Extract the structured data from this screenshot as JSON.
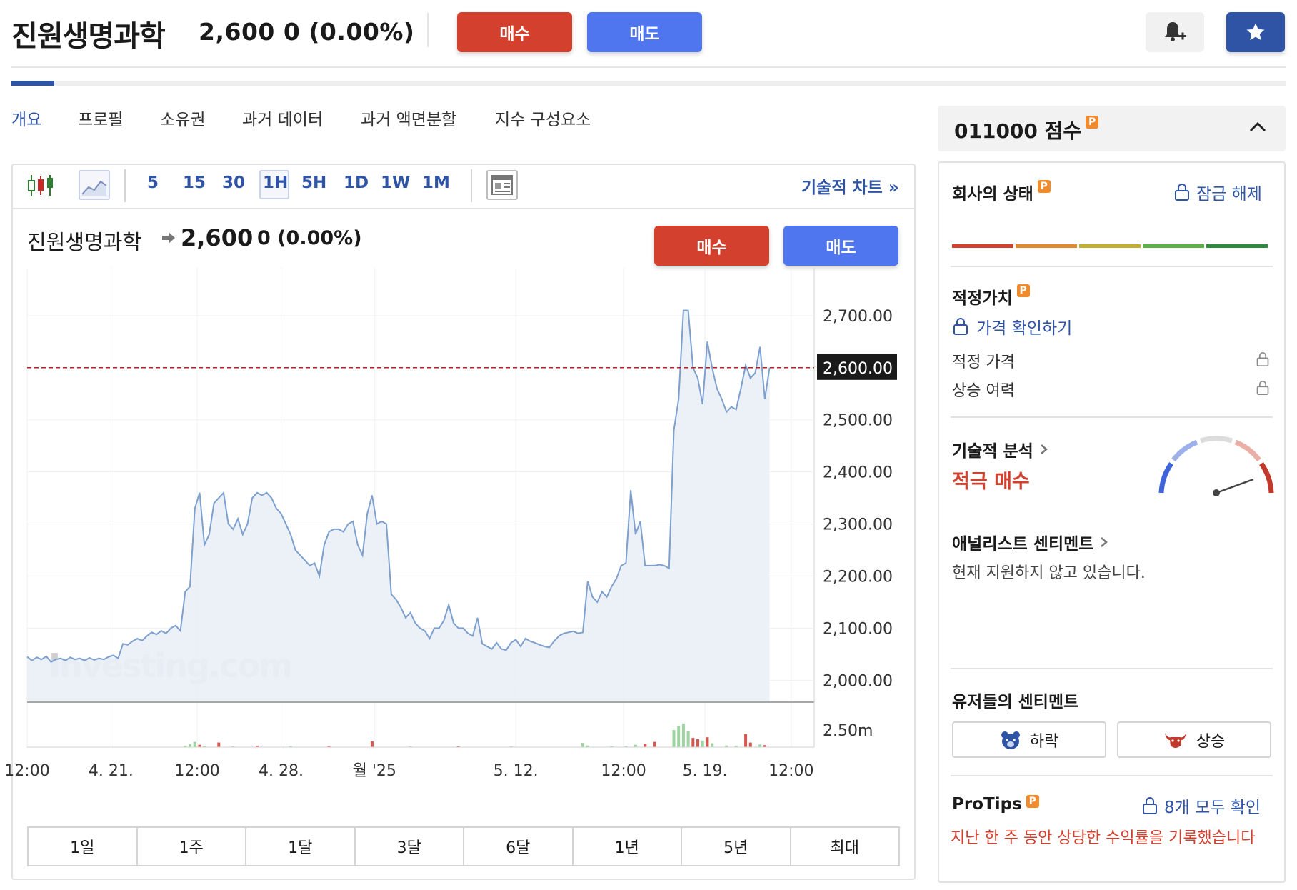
{
  "header": {
    "title": "진원생명과학",
    "price_line": "2,600  0  (0.00%)",
    "buy_label": "매수",
    "sell_label": "매도"
  },
  "tabs": [
    "개요",
    "프로필",
    "소유권",
    "과거 데이터",
    "과거 액면분할",
    "지수 구성요소"
  ],
  "toolbar": {
    "intervals": [
      "5",
      "15",
      "30",
      "1H",
      "5H",
      "1D",
      "1W",
      "1M"
    ],
    "selected_interval": "1H",
    "tech_chart_label": "기술적 차트 »"
  },
  "chart_header": {
    "title": "진원생명과학",
    "price": "2,600",
    "change": "0  (0.00%)",
    "buy_label": "매수",
    "sell_label": "매도"
  },
  "ranges": [
    "1일",
    "1주",
    "1달",
    "3달",
    "6달",
    "1년",
    "5년",
    "최대"
  ],
  "right": {
    "score_title": "011000 점수",
    "health_title": "회사의 상태",
    "unlock_label": "잠금 해제",
    "fair_value_title": "적정가치",
    "check_price_label": "가격 확인하기",
    "fair_price_label": "적정 가격",
    "upside_label": "상승 여력",
    "tech_title": "기술적 분석",
    "tech_signal": "적극 매수",
    "analyst_title": "애널리스트 센티멘트",
    "analyst_text": "현재 지원하지 않고 있습니다.",
    "user_title": "유저들의 센티멘트",
    "bear_label": "하락",
    "bull_label": "상승",
    "protips_title": "ProTips",
    "protips_link": "8개 모두 확인",
    "protip_text": "지난 한 주 동안 상당한 수익률을 기록했습니다"
  },
  "colors": {
    "buy": "#d3402e",
    "sell": "#4f76ee",
    "accent": "#2f54a6",
    "line": "#7ea0cf",
    "area": "#eaeef6",
    "volume_up": "#9dd3a0",
    "volume_down": "#d6574f"
  },
  "chart_data": {
    "type": "area",
    "y_ticks": [
      "2,700.00",
      "2,600.00",
      "2,500.00",
      "2,400.00",
      "2,300.00",
      "2,200.00",
      "2,100.00",
      "2,000.00"
    ],
    "y_tick_values": [
      2700,
      2600,
      2500,
      2400,
      2300,
      2200,
      2100,
      2000
    ],
    "ylim": [
      1958,
      2778
    ],
    "current_value": 2600,
    "current_label": "2,600.00",
    "volume_tick": "2.50m",
    "x_ticks": [
      "12:00",
      "4. 21.",
      "12:00",
      "4. 28.",
      "월 '25",
      "5. 12.",
      "12:00",
      "5. 19.",
      "12:00"
    ],
    "x_tick_positions": [
      0,
      17.5,
      35.5,
      53,
      72.5,
      102,
      124.5,
      141.5,
      159.5
    ],
    "xlim": [
      0,
      164
    ],
    "watermark": "Investing.com",
    "series": [
      {
        "values": [
          [
            0,
            2045
          ],
          [
            1,
            2038
          ],
          [
            2,
            2044
          ],
          [
            3,
            2040
          ],
          [
            4,
            2046
          ],
          [
            5,
            2035
          ],
          [
            6,
            2040
          ],
          [
            7,
            2042
          ],
          [
            8,
            2038
          ],
          [
            9,
            2044
          ],
          [
            10,
            2040
          ],
          [
            11,
            2042
          ],
          [
            12,
            2038
          ],
          [
            13,
            2043
          ],
          [
            14,
            2039
          ],
          [
            15,
            2042
          ],
          [
            16,
            2040
          ],
          [
            17,
            2045
          ],
          [
            18,
            2048
          ],
          [
            19,
            2042
          ],
          [
            20,
            2070
          ],
          [
            21,
            2068
          ],
          [
            22,
            2075
          ],
          [
            23,
            2080
          ],
          [
            24,
            2076
          ],
          [
            25,
            2085
          ],
          [
            26,
            2092
          ],
          [
            27,
            2088
          ],
          [
            28,
            2095
          ],
          [
            29,
            2090
          ],
          [
            30,
            2100
          ],
          [
            31,
            2105
          ],
          [
            32,
            2095
          ],
          [
            33,
            2170
          ],
          [
            34,
            2180
          ],
          [
            35,
            2330
          ],
          [
            36,
            2360
          ],
          [
            37,
            2260
          ],
          [
            38,
            2280
          ],
          [
            39,
            2340
          ],
          [
            40,
            2350
          ],
          [
            41,
            2360
          ],
          [
            42,
            2300
          ],
          [
            43,
            2290
          ],
          [
            44,
            2310
          ],
          [
            45,
            2280
          ],
          [
            46,
            2300
          ],
          [
            47,
            2350
          ],
          [
            48,
            2360
          ],
          [
            49,
            2355
          ],
          [
            50,
            2360
          ],
          [
            51,
            2350
          ],
          [
            52,
            2330
          ],
          [
            53,
            2320
          ],
          [
            54,
            2300
          ],
          [
            55,
            2280
          ],
          [
            56,
            2250
          ],
          [
            57,
            2240
          ],
          [
            58,
            2230
          ],
          [
            59,
            2220
          ],
          [
            60,
            2225
          ],
          [
            61,
            2200
          ],
          [
            62,
            2260
          ],
          [
            63,
            2285
          ],
          [
            64,
            2290
          ],
          [
            65,
            2290
          ],
          [
            66,
            2285
          ],
          [
            67,
            2300
          ],
          [
            68,
            2305
          ],
          [
            69,
            2260
          ],
          [
            70,
            2240
          ],
          [
            71,
            2320
          ],
          [
            72,
            2355
          ],
          [
            73,
            2300
          ],
          [
            74,
            2305
          ],
          [
            75,
            2300
          ],
          [
            76,
            2165
          ],
          [
            77,
            2155
          ],
          [
            78,
            2140
          ],
          [
            79,
            2120
          ],
          [
            80,
            2130
          ],
          [
            81,
            2110
          ],
          [
            82,
            2100
          ],
          [
            83,
            2095
          ],
          [
            84,
            2080
          ],
          [
            85,
            2100
          ],
          [
            86,
            2100
          ],
          [
            87,
            2115
          ],
          [
            88,
            2145
          ],
          [
            89,
            2110
          ],
          [
            90,
            2100
          ],
          [
            91,
            2100
          ],
          [
            92,
            2090
          ],
          [
            93,
            2085
          ],
          [
            94,
            2120
          ],
          [
            95,
            2070
          ],
          [
            96,
            2065
          ],
          [
            97,
            2060
          ],
          [
            98,
            2072
          ],
          [
            99,
            2060
          ],
          [
            100,
            2058
          ],
          [
            101,
            2072
          ],
          [
            102,
            2078
          ],
          [
            103,
            2065
          ],
          [
            104,
            2080
          ],
          [
            105,
            2075
          ],
          [
            106,
            2072
          ],
          [
            107,
            2068
          ],
          [
            108,
            2065
          ],
          [
            109,
            2063
          ],
          [
            110,
            2075
          ],
          [
            111,
            2085
          ],
          [
            112,
            2090
          ],
          [
            113,
            2092
          ],
          [
            114,
            2094
          ],
          [
            115,
            2090
          ],
          [
            116,
            2092
          ],
          [
            117,
            2190
          ],
          [
            118,
            2160
          ],
          [
            119,
            2150
          ],
          [
            120,
            2170
          ],
          [
            121,
            2160
          ],
          [
            122,
            2180
          ],
          [
            123,
            2195
          ],
          [
            124,
            2220
          ],
          [
            125,
            2225
          ],
          [
            126,
            2365
          ],
          [
            127,
            2280
          ],
          [
            128,
            2305
          ],
          [
            129,
            2220
          ],
          [
            130,
            2220
          ],
          [
            131,
            2220
          ],
          [
            132,
            2222
          ],
          [
            133,
            2220
          ],
          [
            134,
            2215
          ],
          [
            135,
            2480
          ],
          [
            136,
            2540
          ],
          [
            137,
            2710
          ],
          [
            138,
            2710
          ],
          [
            139,
            2600
          ],
          [
            140,
            2580
          ],
          [
            141,
            2530
          ],
          [
            142,
            2650
          ],
          [
            143,
            2600
          ],
          [
            144,
            2560
          ],
          [
            145,
            2540
          ],
          [
            146,
            2515
          ],
          [
            147,
            2525
          ],
          [
            148,
            2520
          ],
          [
            149,
            2560
          ],
          [
            150,
            2605
          ],
          [
            151,
            2580
          ],
          [
            152,
            2590
          ],
          [
            153,
            2640
          ],
          [
            154,
            2540
          ],
          [
            155,
            2600
          ]
        ]
      }
    ],
    "volume": [
      {
        "x": 33,
        "v": 0.1,
        "dir": "up"
      },
      {
        "x": 34,
        "v": 0.22,
        "dir": "up"
      },
      {
        "x": 35,
        "v": 0.4,
        "dir": "up"
      },
      {
        "x": 36,
        "v": 0.18,
        "dir": "down"
      },
      {
        "x": 37,
        "v": 0.08,
        "dir": "up"
      },
      {
        "x": 40,
        "v": 0.35,
        "dir": "down"
      },
      {
        "x": 43,
        "v": 0.06,
        "dir": "up"
      },
      {
        "x": 48,
        "v": 0.1,
        "dir": "down"
      },
      {
        "x": 55,
        "v": 0.08,
        "dir": "up"
      },
      {
        "x": 63,
        "v": 0.08,
        "dir": "down"
      },
      {
        "x": 72,
        "v": 0.45,
        "dir": "down"
      },
      {
        "x": 80,
        "v": 0.06,
        "dir": "up"
      },
      {
        "x": 90,
        "v": 0.06,
        "dir": "down"
      },
      {
        "x": 101,
        "v": 0.05,
        "dir": "up"
      },
      {
        "x": 116,
        "v": 0.32,
        "dir": "up"
      },
      {
        "x": 117,
        "v": 0.12,
        "dir": "up"
      },
      {
        "x": 122,
        "v": 0.06,
        "dir": "up"
      },
      {
        "x": 125,
        "v": 0.08,
        "dir": "up"
      },
      {
        "x": 127,
        "v": 0.18,
        "dir": "up"
      },
      {
        "x": 129,
        "v": 0.25,
        "dir": "down"
      },
      {
        "x": 131,
        "v": 0.4,
        "dir": "down"
      },
      {
        "x": 135,
        "v": 1.3,
        "dir": "up"
      },
      {
        "x": 136,
        "v": 1.6,
        "dir": "up"
      },
      {
        "x": 137,
        "v": 1.8,
        "dir": "up"
      },
      {
        "x": 138,
        "v": 1.2,
        "dir": "up"
      },
      {
        "x": 139,
        "v": 0.7,
        "dir": "down"
      },
      {
        "x": 140,
        "v": 0.6,
        "dir": "down"
      },
      {
        "x": 141,
        "v": 0.5,
        "dir": "up"
      },
      {
        "x": 142,
        "v": 0.75,
        "dir": "down"
      },
      {
        "x": 143,
        "v": 0.3,
        "dir": "up"
      },
      {
        "x": 146,
        "v": 0.12,
        "dir": "up"
      },
      {
        "x": 148,
        "v": 0.1,
        "dir": "up"
      },
      {
        "x": 150,
        "v": 1.0,
        "dir": "down"
      },
      {
        "x": 151,
        "v": 0.35,
        "dir": "down"
      },
      {
        "x": 153,
        "v": 0.2,
        "dir": "up"
      },
      {
        "x": 154,
        "v": 0.15,
        "dir": "down"
      }
    ],
    "volume_ylim": [
      0,
      2.5
    ]
  }
}
